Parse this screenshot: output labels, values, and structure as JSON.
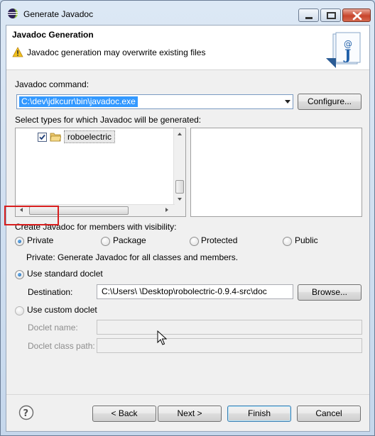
{
  "window": {
    "title": "Generate Javadoc",
    "icons": {
      "app": "eclipse-icon",
      "minimize": "minimize-icon",
      "maximize": "maximize-icon",
      "close": "close-icon"
    }
  },
  "header": {
    "title": "Javadoc Generation",
    "message": "Javadoc generation may overwrite existing files",
    "icons": {
      "warning": "warning-icon",
      "logo": "javadoc-logo-icon"
    }
  },
  "javadoc_command": {
    "label": "Javadoc command:",
    "value": "C:\\dev\\jdkcurr\\bin\\javadoc.exe",
    "configure_label": "Configure..."
  },
  "types": {
    "label": "Select types for which Javadoc will be generated:",
    "tree_items": [
      {
        "label": "roboelectric",
        "checked": true
      }
    ]
  },
  "visibility": {
    "label": "Create Javadoc for members with visibility:",
    "options": [
      "Private",
      "Package",
      "Protected",
      "Public"
    ],
    "selected": "Private",
    "description": "Private: Generate Javadoc for all classes and members."
  },
  "standard_doclet": {
    "label": "Use standard doclet",
    "selected": true,
    "destination_label": "Destination:",
    "destination_value": "C:\\Users\\            \\Desktop\\robolectric-0.9.4-src\\doc",
    "browse_label": "Browse..."
  },
  "custom_doclet": {
    "label": "Use custom doclet",
    "selected": false,
    "doclet_name_label": "Doclet name:",
    "doclet_class_path_label": "Doclet class path:"
  },
  "footer": {
    "back_label": "< Back",
    "next_label": "Next >",
    "finish_label": "Finish",
    "cancel_label": "Cancel",
    "help_icon": "help-icon"
  },
  "colors": {
    "highlight_border": "#d81e1e",
    "selection": "#3399ff",
    "radio_dot": "#1a5fa8"
  }
}
